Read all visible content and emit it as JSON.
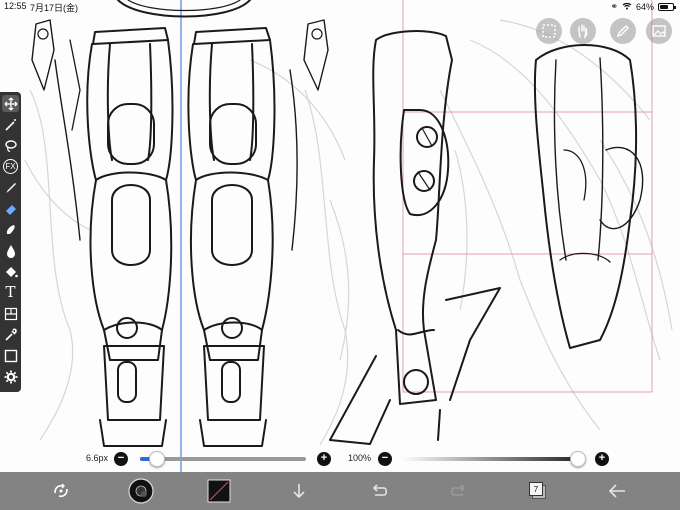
{
  "status_bar": {
    "time": "12:55",
    "date": "7月17日(金)",
    "battery_percent": "64%",
    "battery_level": 0.64
  },
  "top_buttons": [
    {
      "name": "selection-icon"
    },
    {
      "name": "hand-icon"
    },
    {
      "name": "pen-icon"
    },
    {
      "name": "image-icon"
    }
  ],
  "tools": [
    "move-icon",
    "magic-wand-icon",
    "lasso-icon",
    "filter-icon",
    "brush-icon",
    "eraser-icon",
    "smudge-icon",
    "blur-icon",
    "fill-icon",
    "text-icon",
    "frame-divider-icon",
    "eyedropper-icon",
    "canvas-icon",
    "settings-icon"
  ],
  "tool_labels": {
    "filter": "FX",
    "text": "T"
  },
  "brush_size": {
    "label": "6.6px",
    "level": 0.1
  },
  "brush_opacity": {
    "label": "100%",
    "level": 1.0
  },
  "bottom_bar": {
    "layer_count": "7",
    "primary_color": "#111111",
    "accent": "#2d6cdf"
  }
}
